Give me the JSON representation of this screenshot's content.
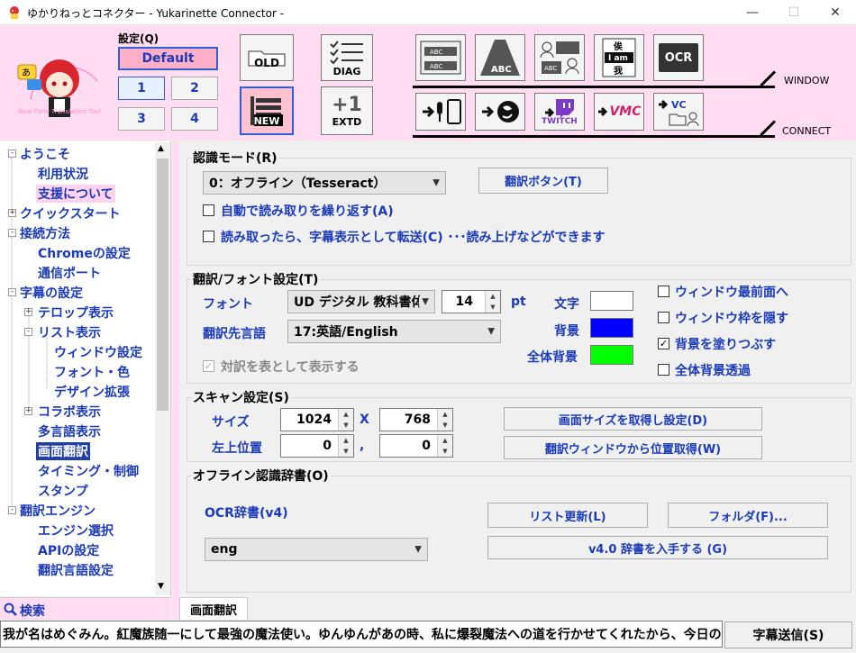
{
  "window": {
    "title": "ゆかりねっとコネクター  - Yukarinette Connector -",
    "minimize": "—",
    "maximize": "☐",
    "close": "✕"
  },
  "toolbar": {
    "preset_label": "設定(Q)",
    "preset_default": "Default",
    "presets": [
      "1",
      "2",
      "3",
      "4"
    ],
    "old": "OLD",
    "new": "NEW",
    "diag": "DIAG",
    "extd": "EXTD",
    "window_label": "WINDOW",
    "connect_label": "CONNECT",
    "ocr": "OCR",
    "twitch": "TWITCH",
    "vmc": "VMC",
    "vc": "VC",
    "logo_text": "Real-Time Translation Tool",
    "window_tile_text": {
      "abc": "ABC",
      "kanji1": "俟",
      "iam": "I am",
      "kanji2": "我"
    }
  },
  "tree": {
    "items": [
      {
        "label": "ようこそ",
        "level": 0,
        "exp": "-"
      },
      {
        "label": "利用状況",
        "level": 1
      },
      {
        "label": "支援について",
        "level": 1,
        "highlight": true
      },
      {
        "label": "クイックスタート",
        "level": 0,
        "exp": "+"
      },
      {
        "label": "接続方法",
        "level": 0,
        "exp": "-"
      },
      {
        "label": "Chromeの設定",
        "level": 1
      },
      {
        "label": "通信ポート",
        "level": 1
      },
      {
        "label": "字幕の設定",
        "level": 0,
        "exp": "-"
      },
      {
        "label": "テロップ表示",
        "level": 1,
        "exp": "+"
      },
      {
        "label": "リスト表示",
        "level": 1,
        "exp": "-"
      },
      {
        "label": "ウィンドウ設定",
        "level": 2
      },
      {
        "label": "フォント・色",
        "level": 2
      },
      {
        "label": "デザイン拡張",
        "level": 2
      },
      {
        "label": "コラボ表示",
        "level": 1,
        "exp": "+"
      },
      {
        "label": "多言語表示",
        "level": 1
      },
      {
        "label": "画面翻訳",
        "level": 1,
        "selected": true
      },
      {
        "label": "タイミング・制御",
        "level": 1
      },
      {
        "label": "スタンプ",
        "level": 1
      },
      {
        "label": "翻訳エンジン",
        "level": 0,
        "exp": "-"
      },
      {
        "label": "エンジン選択",
        "level": 1
      },
      {
        "label": "APIの設定",
        "level": 1
      },
      {
        "label": "翻訳言語設定",
        "level": 1
      }
    ]
  },
  "search": {
    "label": "検索"
  },
  "recognition": {
    "title": "認識モード(R)",
    "mode_value": "0：オフライン（Tesseract）",
    "translate_button": "翻訳ボタン(T)",
    "auto_repeat": "自動で読み取りを繰り返す(A)",
    "forward": "読み取ったら、字幕表示として転送(C) ･･･読み上げなどができます"
  },
  "font_settings": {
    "title": "翻訳/フォント設定(T)",
    "font_label": "フォント",
    "font_value": "UD デジタル 教科書体",
    "size_value": "14",
    "size_unit": "pt",
    "target_label": "翻訳先言語",
    "target_value": "17:英語/English",
    "text_label": "文字",
    "bg_label": "背景",
    "allbg_label": "全体背景",
    "text_color": "#ffffff",
    "bg_color": "#0000ff",
    "allbg_color": "#00ff00",
    "table_check": "対訳を表として表示する",
    "topmost": "ウィンドウ最前面へ",
    "hide_frame": "ウィンドウ枠を隠す",
    "fill_bg": "背景を塗りつぶす",
    "transparent": "全体背景透過"
  },
  "scan": {
    "title": "スキャン設定(S)",
    "size_label": "サイズ",
    "width": "1024",
    "x_sep": "X",
    "height": "768",
    "pos_label": "左上位置",
    "left": "0",
    "comma": ",",
    "top": "0",
    "get_size_button": "画面サイズを取得し設定(D)",
    "get_pos_button": "翻訳ウィンドウから位置取得(W)"
  },
  "dictionary": {
    "title": "オフライン認識辞書(O)",
    "ocr_label": "OCR辞書(v4)",
    "value": "eng",
    "refresh_button": "リスト更新(L)",
    "folder_button": "フォルダ(F)...",
    "get_button": "v4.0 辞書を入手する (G)"
  },
  "tab": {
    "label": "画面翻訳"
  },
  "bottom": {
    "message": "我が名はめぐみん。紅魔族随一にして最強の魔法使い。ゆんゆんがあの時、私に爆裂魔法への道を行かせてくれたから、今日の私がいる",
    "send_button": "字幕送信(S)"
  }
}
